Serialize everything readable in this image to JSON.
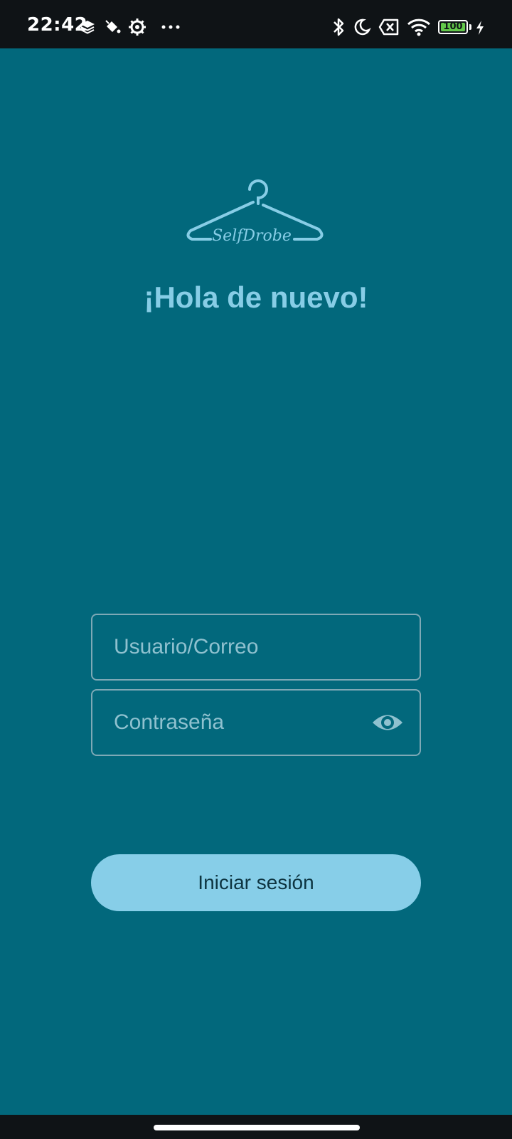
{
  "status_bar": {
    "time": "22:42",
    "battery_level": "100",
    "icons": [
      "layers-icon",
      "paint-bucket-icon",
      "settings-gear-icon",
      "more-dots-icon",
      "bluetooth-icon",
      "moon-icon",
      "sim-off-icon",
      "wifi-icon",
      "battery-icon",
      "charging-bolt-icon"
    ]
  },
  "logo": {
    "text": "SelfDrobe",
    "icon": "hanger-icon"
  },
  "greeting": "¡Hola de nuevo!",
  "form": {
    "username_placeholder": "Usuario/Correo",
    "username_value": "",
    "password_placeholder": "Contraseña",
    "password_value": "",
    "toggle_icon": "eye-icon",
    "submit_label": "Iniciar sesión"
  },
  "colors": {
    "background": "#02687c",
    "accent": "#87cee8",
    "status_bar": "#0f1316"
  }
}
